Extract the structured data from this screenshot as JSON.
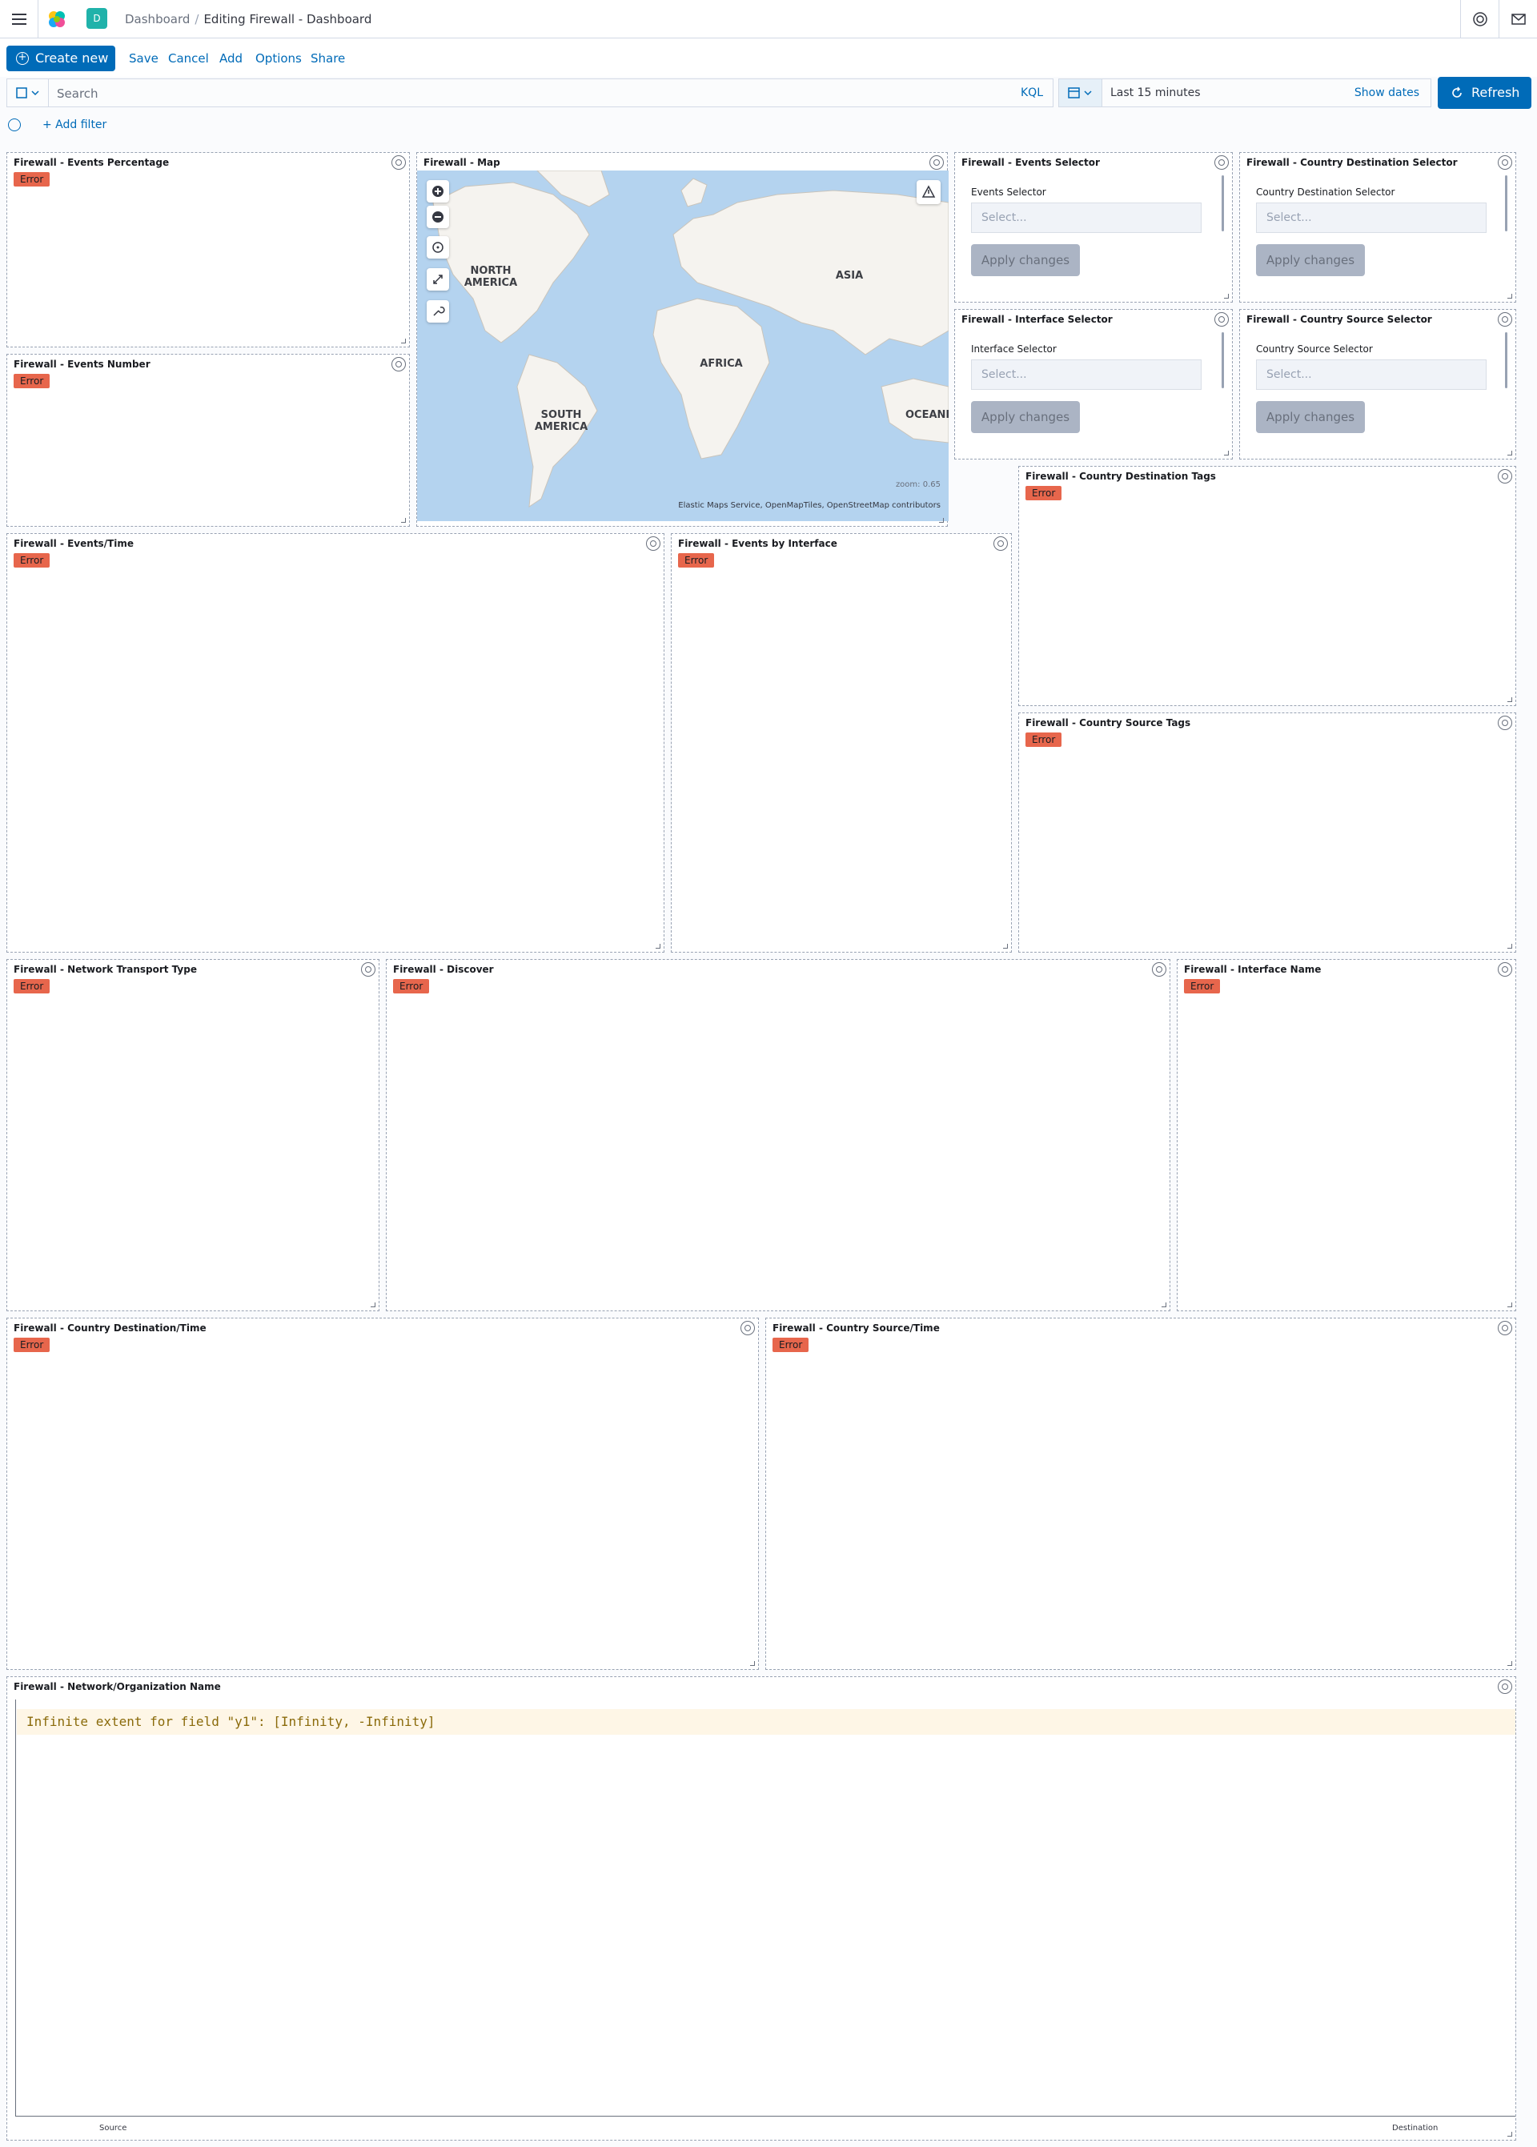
{
  "header": {
    "space_initial": "D",
    "breadcrumbs": [
      "Dashboard",
      "Editing Firewall - Dashboard"
    ]
  },
  "topnav": {
    "create_new": "Create new",
    "save": "Save",
    "cancel": "Cancel",
    "add": "Add",
    "options": "Options",
    "share": "Share"
  },
  "query": {
    "placeholder": "Search",
    "language": "KQL",
    "time_range": "Last 15 minutes",
    "show_dates": "Show dates",
    "refresh": "Refresh",
    "add_filter": "+ Add filter"
  },
  "colors": {
    "primary": "#006bb8",
    "error_badge": "#e7664c",
    "map_water": "#b4d3ef",
    "map_land": "#f5f3ef"
  },
  "panels": {
    "events_percentage": {
      "title": "Firewall - Events Percentage",
      "status": "Error"
    },
    "events_number": {
      "title": "Firewall - Events Number",
      "status": "Error"
    },
    "map": {
      "title": "Firewall - Map",
      "labels": {
        "north_america": "NORTH AMERICA",
        "south_america": "SOUTH AMERICA",
        "africa": "AFRICA",
        "asia": "ASIA",
        "oceania": "OCEANI"
      },
      "zoom_label": "zoom:",
      "zoom_value": "0.65",
      "attribution": "Elastic Maps Service, OpenMapTiles, OpenStreetMap contributors"
    },
    "events_selector": {
      "title": "Firewall - Events Selector",
      "label": "Events Selector",
      "placeholder": "Select...",
      "apply": "Apply changes"
    },
    "country_destination_selector": {
      "title": "Firewall - Country Destination Selector",
      "label": "Country Destination Selector",
      "placeholder": "Select...",
      "apply": "Apply changes"
    },
    "interface_selector": {
      "title": "Firewall - Interface Selector",
      "label": "Interface Selector",
      "placeholder": "Select...",
      "apply": "Apply changes"
    },
    "country_source_selector": {
      "title": "Firewall - Country Source Selector",
      "label": "Country Source Selector",
      "placeholder": "Select...",
      "apply": "Apply changes"
    },
    "country_destination_tags": {
      "title": "Firewall - Country Destination Tags",
      "status": "Error"
    },
    "country_source_tags": {
      "title": "Firewall - Country Source Tags",
      "status": "Error"
    },
    "events_time": {
      "title": "Firewall - Events/Time",
      "status": "Error"
    },
    "events_by_interface": {
      "title": "Firewall - Events by Interface",
      "status": "Error"
    },
    "network_transport_type": {
      "title": "Firewall - Network Transport Type",
      "status": "Error"
    },
    "discover": {
      "title": "Firewall - Discover",
      "status": "Error"
    },
    "interface_name": {
      "title": "Firewall - Interface Name",
      "status": "Error"
    },
    "country_destination_time": {
      "title": "Firewall - Country Destination/Time",
      "status": "Error"
    },
    "country_source_time": {
      "title": "Firewall - Country Source/Time",
      "status": "Error"
    },
    "network_org_name": {
      "title": "Firewall - Network/Organization Name",
      "error_message": "Infinite extent for field \"y1\": [Infinity, -Infinity]",
      "x_labels": [
        "Source",
        "Destination"
      ]
    }
  }
}
